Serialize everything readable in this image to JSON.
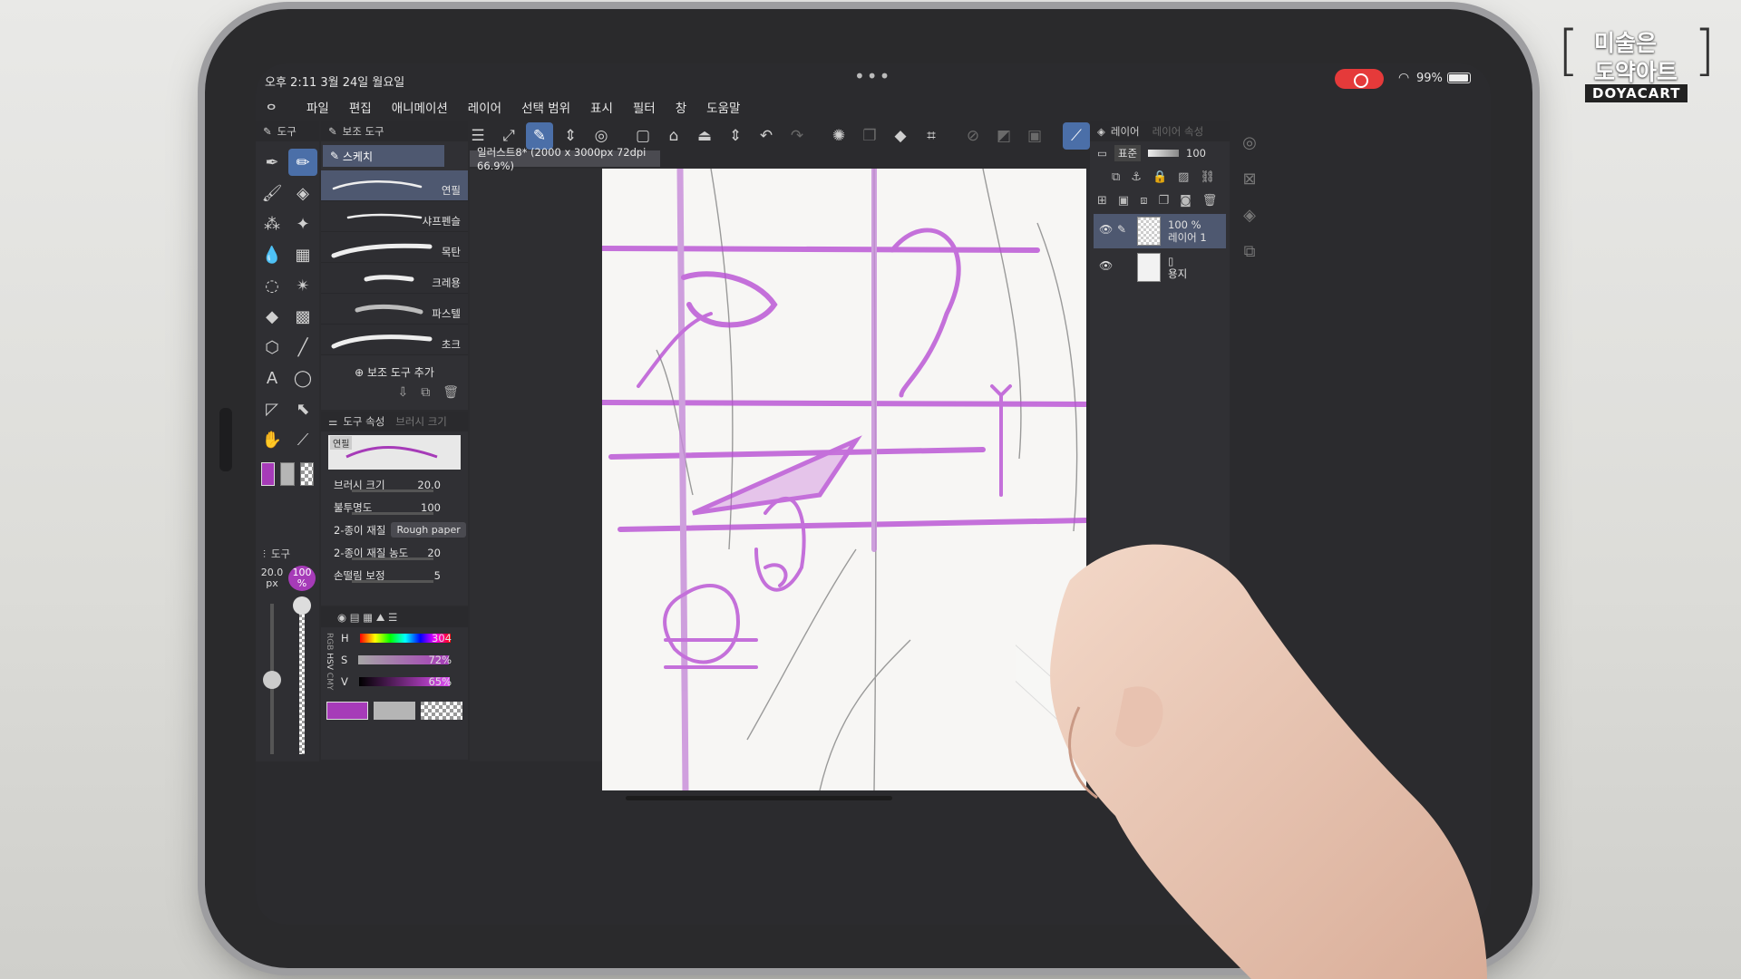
{
  "status": {
    "time": "오후 2:11  3월 24일 월요일",
    "battery": "99%"
  },
  "menu": [
    "파일",
    "편집",
    "애니메이션",
    "레이어",
    "선택 범위",
    "표시",
    "필터",
    "창",
    "도움말"
  ],
  "tool_panel": {
    "title": "도구"
  },
  "subtool_panel": {
    "title": "보조 도구",
    "group": "스케치",
    "brushes": [
      "연필",
      "샤프펜슬",
      "목탄",
      "크레용",
      "파스텔",
      "초크"
    ],
    "add_label": "보조 도구 추가"
  },
  "tool_property": {
    "title": "도구 속성",
    "tab2": "브러시 크기",
    "preview_name": "연필",
    "rows": [
      {
        "label": "브러시 크기",
        "value": "20.0"
      },
      {
        "label": "불투명도",
        "value": "100"
      },
      {
        "label": "2-종이 재질",
        "value": "Rough paper"
      },
      {
        "label": "2-종이 재질 농도",
        "value": "20"
      },
      {
        "label": "손떨림 보정",
        "value": "5"
      }
    ]
  },
  "brush_size_panel": {
    "title": "도구",
    "size": "20.0",
    "size_unit": "px",
    "opacity": "100",
    "opacity_unit": "%"
  },
  "color_panel": {
    "h_label": "H",
    "h_value": "304",
    "s_label": "S",
    "s_value": "72%",
    "v_label": "V",
    "v_value": "65%",
    "tabs": [
      "RGB",
      "HSV",
      "CMY"
    ]
  },
  "canvas": {
    "tab_label": "일러스트8* (2000 x 3000px 72dpi 66.9%)"
  },
  "layer_panel": {
    "title": "레이어",
    "title2": "레이어 속성",
    "blend": "표준",
    "opacity": "100",
    "layers": [
      {
        "name": "레이어 1",
        "opacity": "100 %"
      },
      {
        "name": "용지"
      }
    ]
  },
  "colors": {
    "main": "#a63bb8",
    "accent": "#4b6fa8",
    "purple_stroke": "#b84fd4"
  },
  "watermark": {
    "line1": "미술은",
    "line2": "도약아트",
    "line3": "DOYACART"
  }
}
